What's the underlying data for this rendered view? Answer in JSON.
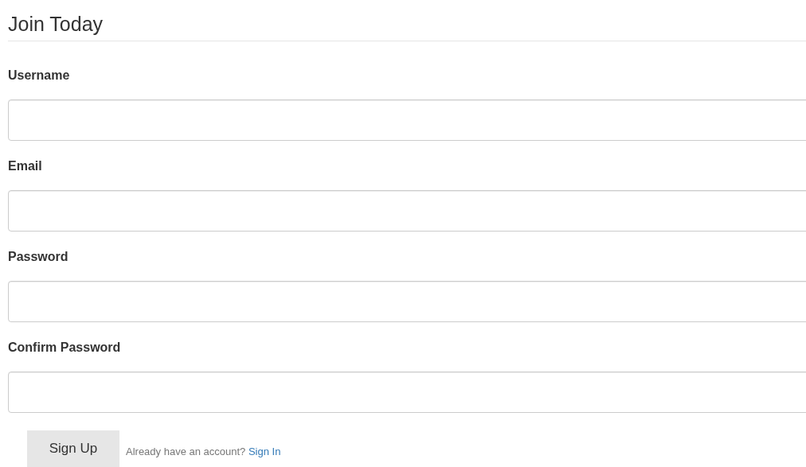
{
  "heading": "Join Today",
  "fields": [
    {
      "label": "Username"
    },
    {
      "label": "Email"
    },
    {
      "label": "Password"
    },
    {
      "label": "Confirm Password"
    }
  ],
  "submit_button": "Sign Up",
  "signin_prompt": {
    "text": "Already have an account?",
    "link": "Sign In"
  }
}
